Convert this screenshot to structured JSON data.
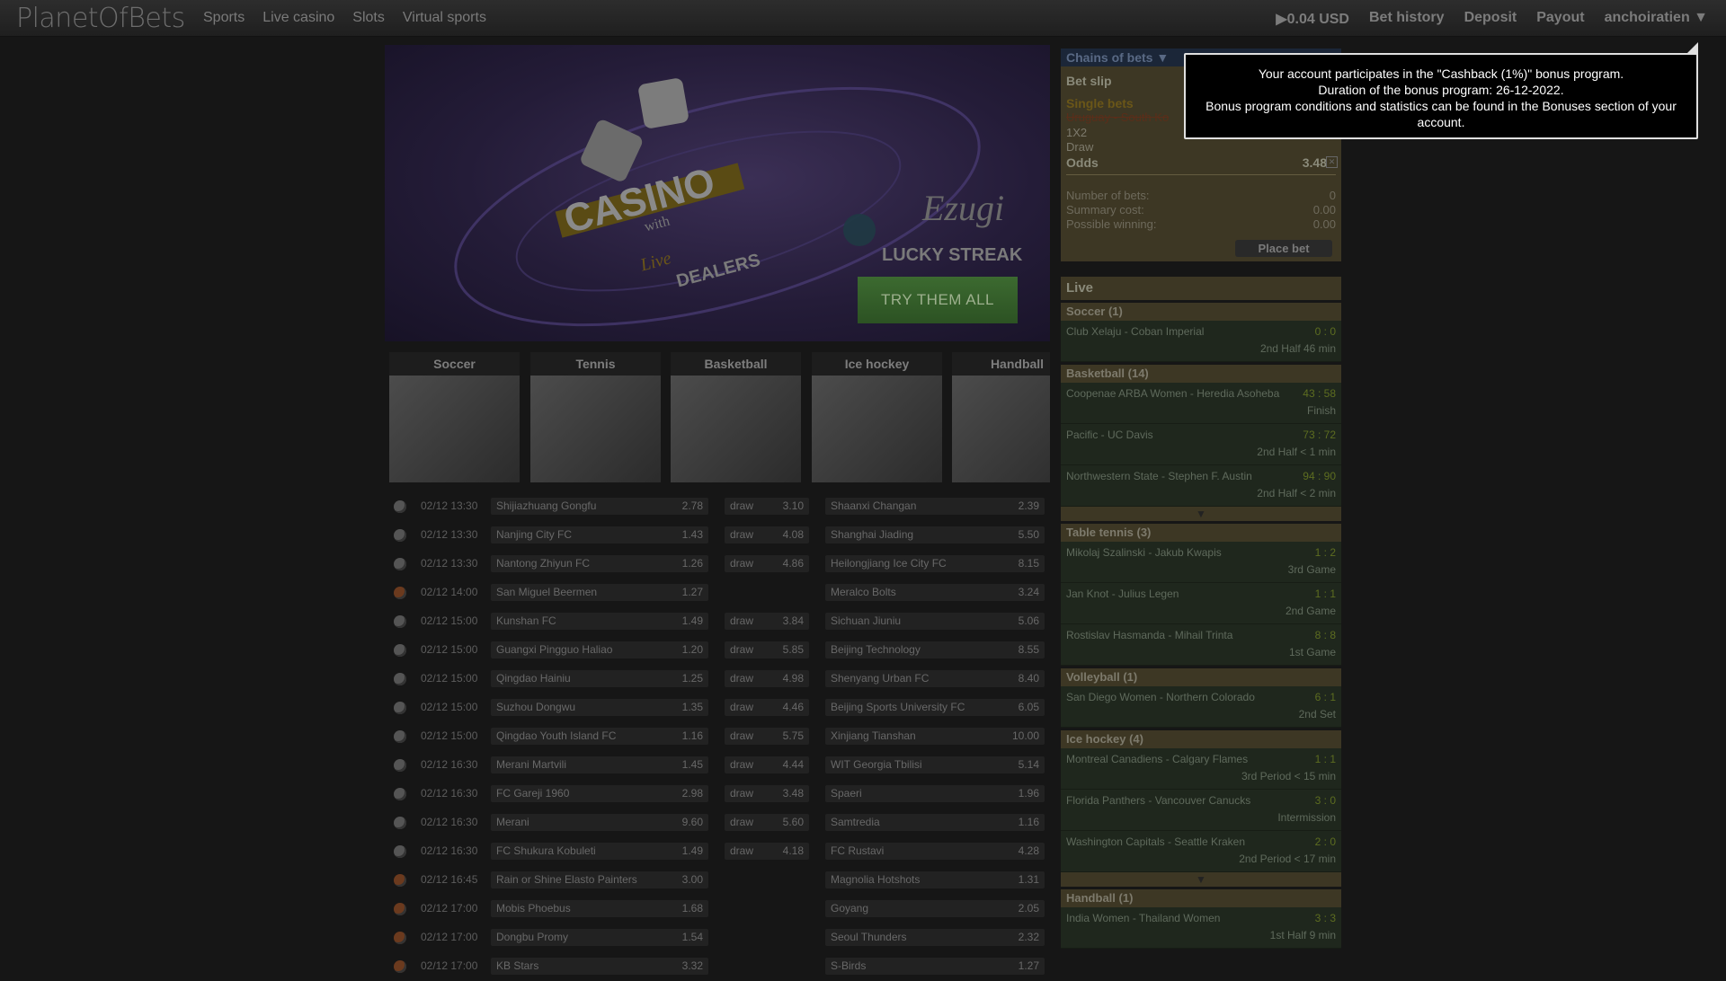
{
  "header": {
    "logo": "PlanetOfBets",
    "nav": [
      "Sports",
      "Live casino",
      "Slots",
      "Virtual sports"
    ],
    "balance": "▶0.04 USD",
    "bet_history": "Bet history",
    "deposit": "Deposit",
    "payout": "Payout",
    "user": "anchoiratien ▼"
  },
  "banner": {
    "title": "CASINO",
    "with": "with",
    "live": "Live",
    "dealers": "DEALERS",
    "brand1": "Ezugi",
    "brand2": "LUCKY STREAK",
    "cta": "TRY THEM ALL"
  },
  "sports_tiles": [
    "Soccer",
    "Tennis",
    "Basketball",
    "Ice hockey",
    "Handball"
  ],
  "matches": [
    {
      "sport": "soccer",
      "time": "02/12 13:30",
      "home": "Shijiazhuang Gongfu",
      "home_odds": "2.78",
      "draw": "draw",
      "draw_odds": "3.10",
      "away": "Shaanxi Changan",
      "away_odds": "2.39"
    },
    {
      "sport": "soccer",
      "time": "02/12 13:30",
      "home": "Nanjing City FC",
      "home_odds": "1.43",
      "draw": "draw",
      "draw_odds": "4.08",
      "away": "Shanghai Jiading",
      "away_odds": "5.50"
    },
    {
      "sport": "soccer",
      "time": "02/12 13:30",
      "home": "Nantong Zhiyun FC",
      "home_odds": "1.26",
      "draw": "draw",
      "draw_odds": "4.86",
      "away": "Heilongjiang Ice City FC",
      "away_odds": "8.15"
    },
    {
      "sport": "basketball",
      "time": "02/12 14:00",
      "home": "San Miguel Beermen",
      "home_odds": "1.27",
      "draw": "",
      "draw_odds": "",
      "away": "Meralco Bolts",
      "away_odds": "3.24"
    },
    {
      "sport": "soccer",
      "time": "02/12 15:00",
      "home": "Kunshan FC",
      "home_odds": "1.49",
      "draw": "draw",
      "draw_odds": "3.84",
      "away": "Sichuan Jiuniu",
      "away_odds": "5.06"
    },
    {
      "sport": "soccer",
      "time": "02/12 15:00",
      "home": "Guangxi Pingguo Haliao",
      "home_odds": "1.20",
      "draw": "draw",
      "draw_odds": "5.85",
      "away": "Beijing Technology",
      "away_odds": "8.55"
    },
    {
      "sport": "soccer",
      "time": "02/12 15:00",
      "home": "Qingdao Hainiu",
      "home_odds": "1.25",
      "draw": "draw",
      "draw_odds": "4.98",
      "away": "Shenyang Urban FC",
      "away_odds": "8.40"
    },
    {
      "sport": "soccer",
      "time": "02/12 15:00",
      "home": "Suzhou Dongwu",
      "home_odds": "1.35",
      "draw": "draw",
      "draw_odds": "4.46",
      "away": "Beijing Sports University FC",
      "away_odds": "6.05"
    },
    {
      "sport": "soccer",
      "time": "02/12 15:00",
      "home": "Qingdao Youth Island FC",
      "home_odds": "1.16",
      "draw": "draw",
      "draw_odds": "5.75",
      "away": "Xinjiang Tianshan",
      "away_odds": "10.00"
    },
    {
      "sport": "soccer",
      "time": "02/12 16:30",
      "home": "Merani Martvili",
      "home_odds": "1.45",
      "draw": "draw",
      "draw_odds": "4.44",
      "away": "WIT Georgia Tbilisi",
      "away_odds": "5.14"
    },
    {
      "sport": "soccer",
      "time": "02/12 16:30",
      "home": "FC Gareji 1960",
      "home_odds": "2.98",
      "draw": "draw",
      "draw_odds": "3.48",
      "away": "Spaeri",
      "away_odds": "1.96"
    },
    {
      "sport": "soccer",
      "time": "02/12 16:30",
      "home": "Merani",
      "home_odds": "9.60",
      "draw": "draw",
      "draw_odds": "5.60",
      "away": "Samtredia",
      "away_odds": "1.16"
    },
    {
      "sport": "soccer",
      "time": "02/12 16:30",
      "home": "FC Shukura Kobuleti",
      "home_odds": "1.49",
      "draw": "draw",
      "draw_odds": "4.18",
      "away": "FC Rustavi",
      "away_odds": "4.28"
    },
    {
      "sport": "basketball",
      "time": "02/12 16:45",
      "home": "Rain or Shine Elasto Painters",
      "home_odds": "3.00",
      "draw": "",
      "draw_odds": "",
      "away": "Magnolia Hotshots",
      "away_odds": "1.31"
    },
    {
      "sport": "basketball",
      "time": "02/12 17:00",
      "home": "Mobis Phoebus",
      "home_odds": "1.68",
      "draw": "",
      "draw_odds": "",
      "away": "Goyang",
      "away_odds": "2.05"
    },
    {
      "sport": "basketball",
      "time": "02/12 17:00",
      "home": "Dongbu Promy",
      "home_odds": "1.54",
      "draw": "",
      "draw_odds": "",
      "away": "Seoul Thunders",
      "away_odds": "2.32"
    },
    {
      "sport": "basketball",
      "time": "02/12 17:00",
      "home": "KB Stars",
      "home_odds": "3.32",
      "draw": "",
      "draw_odds": "",
      "away": "S-Birds",
      "away_odds": "1.27"
    }
  ],
  "bet_slip": {
    "chains": "Chains of bets ▼",
    "title": "Bet slip",
    "single": "Single bets",
    "selection": "Uruguay - South Ko",
    "market": "1X2",
    "outcome": "Draw",
    "odds_label": "Odds",
    "odds_value": "3.48",
    "close": "✕",
    "num_bets_label": "Number of bets:",
    "num_bets": "0",
    "summary_label": "Summary cost:",
    "summary": "0.00",
    "winning_label": "Possible winning:",
    "winning": "0.00",
    "place_bet": "Place bet"
  },
  "live": {
    "title": "Live",
    "more_arrow": "▼",
    "categories": [
      {
        "name": "Soccer (1)",
        "more": false,
        "matches": [
          {
            "teams": "Club Xelaju - Coban Imperial",
            "score": "0 : 0",
            "status": "2nd Half  46 min"
          }
        ]
      },
      {
        "name": "Basketball (14)",
        "more": true,
        "matches": [
          {
            "teams": "Coopenae ARBA Women - Heredia Asoheba",
            "score": "43 : 58",
            "status": "Finish"
          },
          {
            "teams": "Pacific - UC Davis",
            "score": "73 : 72",
            "status": "2nd Half  < 1 min"
          },
          {
            "teams": "Northwestern State - Stephen F. Austin",
            "score": "94 : 90",
            "status": "2nd Half  < 2 min"
          }
        ]
      },
      {
        "name": "Table tennis (3)",
        "more": false,
        "matches": [
          {
            "teams": "Mikolaj Szalinski - Jakub Kwapis",
            "score": "1 : 2",
            "status": "3rd Game"
          },
          {
            "teams": "Jan Knot - Julius Legen",
            "score": "1 : 1",
            "status": "2nd Game"
          },
          {
            "teams": "Rostislav Hasmanda - Mihail Trinta",
            "score": "8 : 8",
            "status": "1st Game"
          }
        ]
      },
      {
        "name": "Volleyball (1)",
        "more": false,
        "matches": [
          {
            "teams": "San Diego Women - Northern Colorado",
            "score": "6 : 1",
            "status": "2nd Set"
          }
        ]
      },
      {
        "name": "Ice hockey (4)",
        "more": true,
        "matches": [
          {
            "teams": "Montreal Canadiens - Calgary Flames",
            "score": "1 : 1",
            "status": "3rd Period  < 15 min"
          },
          {
            "teams": "Florida Panthers - Vancouver Canucks",
            "score": "3 : 0",
            "status": "Intermission"
          },
          {
            "teams": "Washington Capitals - Seattle Kraken",
            "score": "2 : 0",
            "status": "2nd Period  < 17 min"
          }
        ]
      },
      {
        "name": "Handball (1)",
        "more": false,
        "matches": [
          {
            "teams": "India Women - Thailand Women",
            "score": "3 : 3",
            "status": "1st Half  9 min"
          }
        ]
      }
    ]
  },
  "tooltip": {
    "line1": "Your account participates in the \"Cashback (1%)\" bonus program.",
    "line2": "Duration of the bonus program: 26-12-2022.",
    "line3": "Bonus program conditions and statistics can be found in the Bonuses section of your account."
  }
}
